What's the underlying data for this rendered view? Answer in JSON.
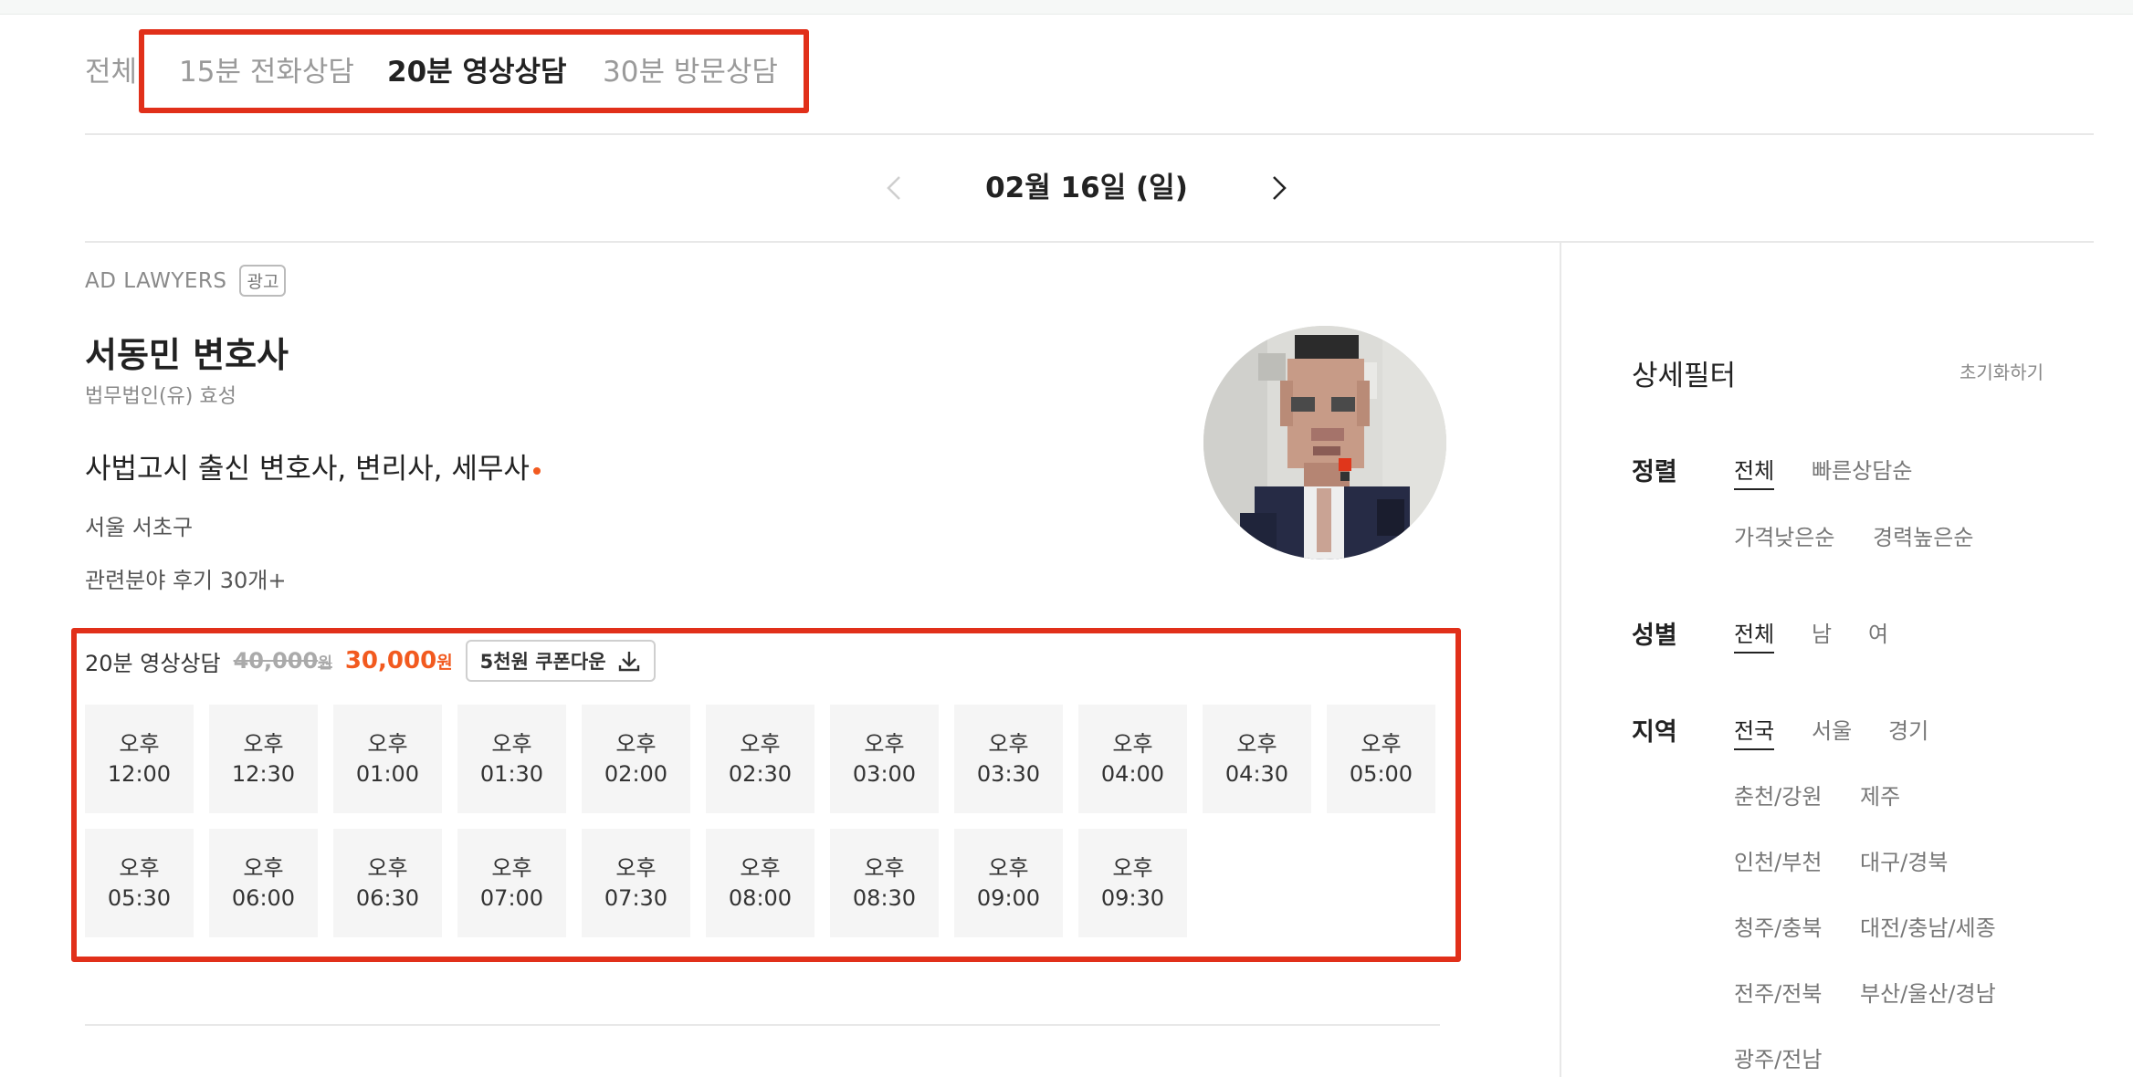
{
  "tabs": {
    "all": "전체",
    "items": [
      {
        "label": "15분 전화상담",
        "active": false
      },
      {
        "label": "20분 영상상담",
        "active": true
      },
      {
        "label": "30분 방문상담",
        "active": false
      }
    ]
  },
  "date_nav": {
    "date": "02월 16일 (일)"
  },
  "lawyer": {
    "ad_label": "AD LAWYERS",
    "ad_badge": "광고",
    "name": "서동민 변호사",
    "firm": "법무법인(유) 효성",
    "headline": "사법고시 출신 변호사, 변리사, 세무사",
    "location": "서울 서초구",
    "reviews": "관련분야 후기 30개+"
  },
  "consult": {
    "type": "20분 영상상담",
    "price_old": "40,000",
    "price_old_unit": "원",
    "price_new": "30,000",
    "price_new_unit": "원",
    "coupon_label": "5천원 쿠폰다운"
  },
  "slots": [
    {
      "period": "오후",
      "time": "12:00"
    },
    {
      "period": "오후",
      "time": "12:30"
    },
    {
      "period": "오후",
      "time": "01:00"
    },
    {
      "period": "오후",
      "time": "01:30"
    },
    {
      "period": "오후",
      "time": "02:00"
    },
    {
      "period": "오후",
      "time": "02:30"
    },
    {
      "period": "오후",
      "time": "03:00"
    },
    {
      "period": "오후",
      "time": "03:30"
    },
    {
      "period": "오후",
      "time": "04:00"
    },
    {
      "period": "오후",
      "time": "04:30"
    },
    {
      "period": "오후",
      "time": "05:00"
    },
    {
      "period": "오후",
      "time": "05:30"
    },
    {
      "period": "오후",
      "time": "06:00"
    },
    {
      "period": "오후",
      "time": "06:30"
    },
    {
      "period": "오후",
      "time": "07:00"
    },
    {
      "period": "오후",
      "time": "07:30"
    },
    {
      "period": "오후",
      "time": "08:00"
    },
    {
      "period": "오후",
      "time": "08:30"
    },
    {
      "period": "오후",
      "time": "09:00"
    },
    {
      "period": "오후",
      "time": "09:30"
    }
  ],
  "filter": {
    "title": "상세필터",
    "reset": "초기화하기",
    "sort": {
      "label": "정렬",
      "options": [
        "전체",
        "빠른상담순",
        "가격낮은순",
        "경력높은순"
      ]
    },
    "gender": {
      "label": "성별",
      "options": [
        "전체",
        "남",
        "여"
      ]
    },
    "region": {
      "label": "지역",
      "options": [
        "전국",
        "서울",
        "경기",
        "춘천/강원",
        "제주",
        "인천/부천",
        "대구/경북",
        "청주/충북",
        "대전/충남/세종",
        "전주/전북",
        "부산/울산/경남",
        "광주/전남"
      ]
    }
  },
  "colors": {
    "accent": "#f25a1f",
    "highlight_box": "#e1301a",
    "slot_bg": "#f5f5f5"
  }
}
